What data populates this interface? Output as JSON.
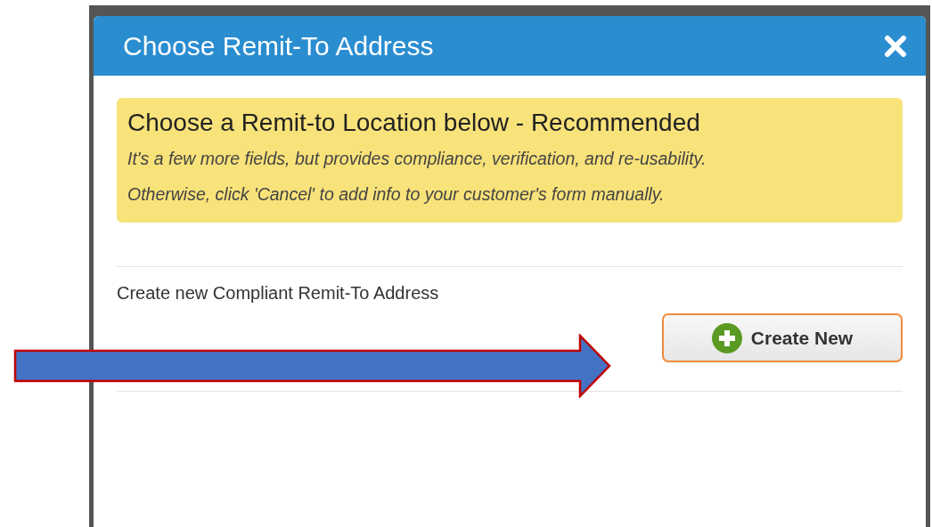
{
  "dialog": {
    "title": "Choose Remit-To Address"
  },
  "notice": {
    "heading": "Choose a Remit-to Location below - Recommended",
    "lines": [
      "It's a few more fields, but provides compliance, verification, and re-usability.",
      "Otherwise, click 'Cancel' to add info to your customer's form manually."
    ]
  },
  "create_section": {
    "label": "Create new Compliant Remit-To Address",
    "button": "Create New"
  }
}
